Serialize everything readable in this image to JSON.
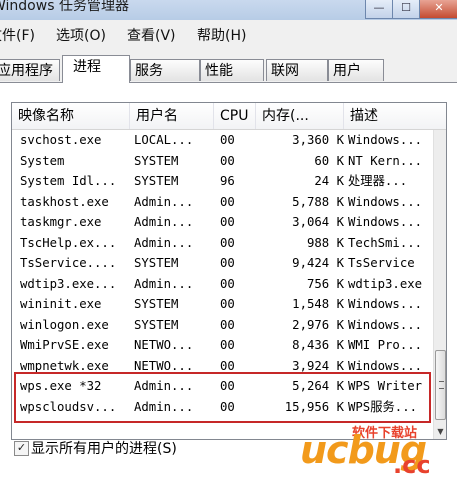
{
  "window": {
    "title": "Windows 任务管理器"
  },
  "menu": {
    "file": "文件(F)",
    "options": "选项(O)",
    "view": "查看(V)",
    "help": "帮助(H)"
  },
  "tabs": {
    "applications": "应用程序",
    "processes": "进程",
    "services": "服务",
    "performance": "性能",
    "networking": "联网",
    "users": "用户",
    "active": "进程"
  },
  "columns": {
    "image_name": "映像名称",
    "user_name": "用户名",
    "cpu": "CPU",
    "memory": "内存(...",
    "description": "描述"
  },
  "processes": [
    {
      "name": "svchost.exe",
      "user": "LOCAL...",
      "cpu": "00",
      "mem": "3,360 K",
      "desc": "Windows..."
    },
    {
      "name": "System",
      "user": "SYSTEM",
      "cpu": "00",
      "mem": "60 K",
      "desc": "NT Kern..."
    },
    {
      "name": "System Idl...",
      "user": "SYSTEM",
      "cpu": "96",
      "mem": "24 K",
      "desc": "处理器..."
    },
    {
      "name": "taskhost.exe",
      "user": "Admin...",
      "cpu": "00",
      "mem": "5,788 K",
      "desc": "Windows..."
    },
    {
      "name": "taskmgr.exe",
      "user": "Admin...",
      "cpu": "00",
      "mem": "3,064 K",
      "desc": "Windows..."
    },
    {
      "name": "TscHelp.ex...",
      "user": "Admin...",
      "cpu": "00",
      "mem": "988 K",
      "desc": "TechSmi..."
    },
    {
      "name": "TsService....",
      "user": "SYSTEM",
      "cpu": "00",
      "mem": "9,424 K",
      "desc": "TsService"
    },
    {
      "name": "wdtip3.exe...",
      "user": "Admin...",
      "cpu": "00",
      "mem": "756 K",
      "desc": "wdtip3.exe"
    },
    {
      "name": "wininit.exe",
      "user": "SYSTEM",
      "cpu": "00",
      "mem": "1,548 K",
      "desc": "Windows..."
    },
    {
      "name": "winlogon.exe",
      "user": "SYSTEM",
      "cpu": "00",
      "mem": "2,976 K",
      "desc": "Windows..."
    },
    {
      "name": "WmiPrvSE.exe",
      "user": "NETWO...",
      "cpu": "00",
      "mem": "8,436 K",
      "desc": "WMI Pro..."
    },
    {
      "name": "wmpnetwk.exe",
      "user": "NETWO...",
      "cpu": "00",
      "mem": "3,924 K",
      "desc": "Windows..."
    },
    {
      "name": "wps.exe *32",
      "user": "Admin...",
      "cpu": "00",
      "mem": "5,264 K",
      "desc": "WPS Writer"
    },
    {
      "name": "wpscloudsv...",
      "user": "Admin...",
      "cpu": "00",
      "mem": "15,956 K",
      "desc": "WPS服务..."
    }
  ],
  "show_all": {
    "label": "显示所有用户的进程(S)",
    "checked": true
  },
  "watermark": {
    "text": "ucbug",
    "suffix": "cc",
    "tagline": "软件下载站"
  }
}
